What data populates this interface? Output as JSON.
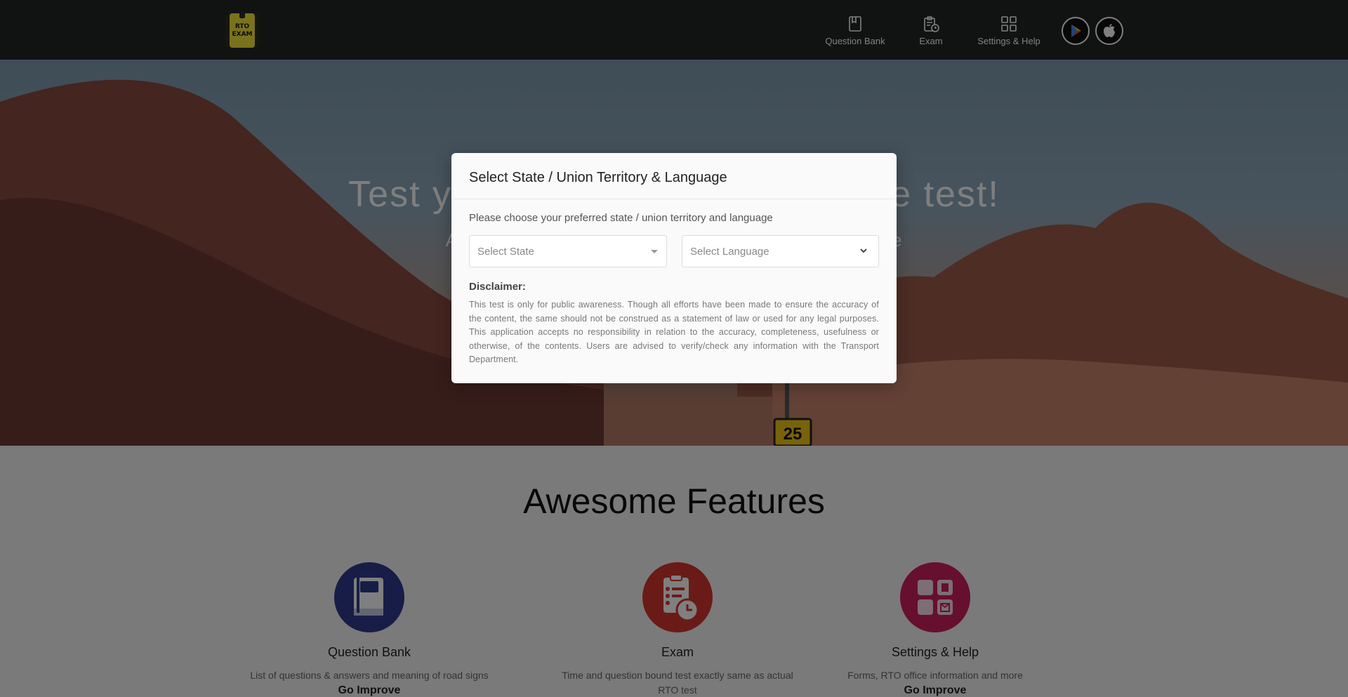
{
  "navbar": {
    "logo_line1": "RTO",
    "logo_line2": "EXAM",
    "items": [
      {
        "label": "Question Bank",
        "icon": "book-icon"
      },
      {
        "label": "Exam",
        "icon": "clipboard-clock-icon"
      },
      {
        "label": "Settings & Help",
        "icon": "grid-icon"
      }
    ],
    "store_buttons": [
      {
        "icon": "google-play-icon"
      },
      {
        "icon": "apple-icon"
      }
    ]
  },
  "hero": {
    "title": "Test yourself for Driving Licence test!",
    "subtitle": "Available in English, Hindi, Marathi and other Native"
  },
  "features": {
    "title": "Awesome Features",
    "items": [
      {
        "title": "Question Bank",
        "description": "List of questions & answers and meaning of road signs",
        "more": "Go Improve",
        "color": "#2e3b8f"
      },
      {
        "title": "Exam",
        "description": "Time and question bound test exactly same as actual RTO test",
        "more": "",
        "color": "#d6362f"
      },
      {
        "title": "Settings & Help",
        "description": "Forms, RTO office information and more",
        "more": "Go Improve",
        "color": "#cf1f5c"
      }
    ]
  },
  "modal": {
    "title": "Select State / Union Territory & Language",
    "instructions": "Please choose your preferred state / union territory and language",
    "state_placeholder": "Select State",
    "language_placeholder": "Select Language",
    "disclaimer_label": "Disclaimer:",
    "disclaimer_text": "This test is only for public awareness. Though all efforts have been made to ensure the accuracy of the content, the same should not be construed as a statement of law or used for any legal purposes. This application accepts no responsibility in relation to the accuracy, completeness, usefulness or otherwise, of the contents. Users are advised to verify/check any information with the Transport Department."
  },
  "road_sign": {
    "speed_value": "25"
  },
  "colors": {
    "navbar": "#232627",
    "modal_bg": "#fafafa",
    "backdrop": "rgba(0,0,0,0.5)"
  }
}
